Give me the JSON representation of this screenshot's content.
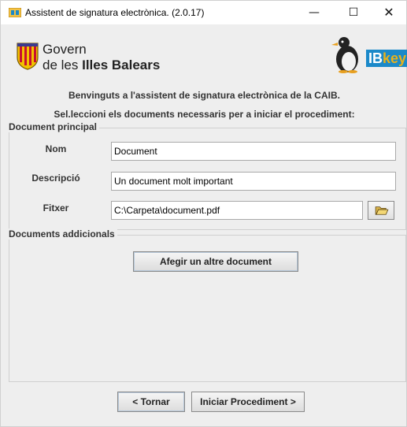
{
  "window": {
    "title": "Assistent de signatura electrònica. (2.0.17)",
    "controls": {
      "minimize": "—",
      "maximize": "☐",
      "close": "✕"
    }
  },
  "header": {
    "gov_line1": "Govern",
    "gov_line2_prefix": "de les ",
    "gov_line2_bold": "Illes Balears",
    "brand_ib": "IB",
    "brand_key": "key"
  },
  "intro": {
    "line1": "Benvinguts a l'assistent de signatura electrònica de la CAIB.",
    "line2": "Sel.leccioni els documents necessaris per a iniciar el procediment:"
  },
  "main_document": {
    "title": "Document principal",
    "fields": {
      "name": {
        "label": "Nom",
        "value": "Document"
      },
      "description": {
        "label": "Descripció",
        "value": "Un document molt important"
      },
      "file": {
        "label": "Fitxer",
        "value": "C:\\Carpeta\\document.pdf",
        "icon": "folder-open-icon"
      }
    }
  },
  "additional_documents": {
    "title": "Documents addicionals",
    "add_button": "Afegir un altre document"
  },
  "footer": {
    "back_button": "< Tornar",
    "start_button": "Iniciar Procediment >"
  },
  "colors": {
    "window_bg": "#eeeeee",
    "brand_blue": "#1b89c9",
    "brand_key": "#e8b21a",
    "crest_red": "#c8102e",
    "crest_yellow": "#f2c200"
  }
}
